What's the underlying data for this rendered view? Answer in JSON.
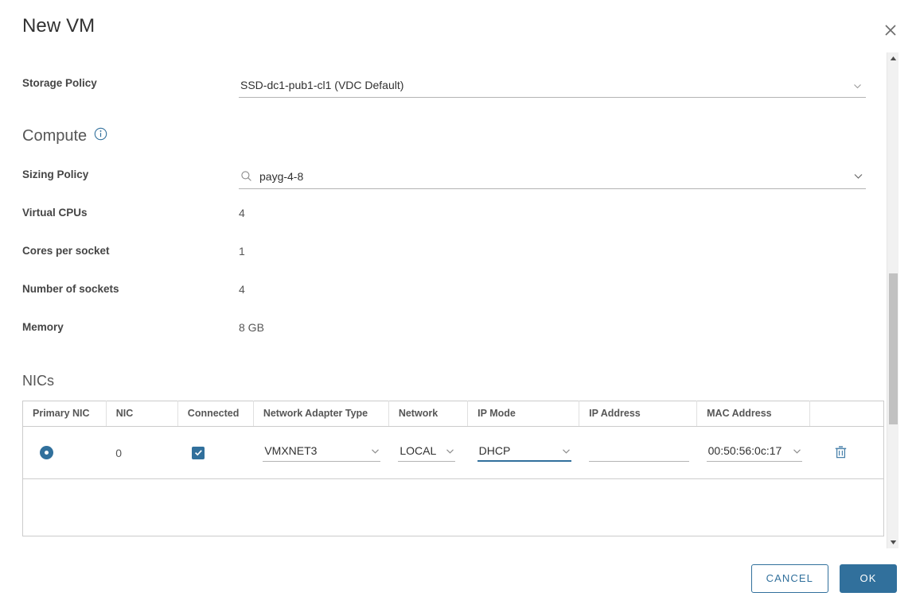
{
  "dialog": {
    "title": "New VM",
    "close_icon": "close-icon"
  },
  "storage": {
    "clipped_label": "",
    "label": "Storage Policy",
    "value": "SSD-dc1-pub1-cl1 (VDC Default)"
  },
  "compute": {
    "heading": "Compute",
    "info_icon": "info-icon",
    "sizing_policy": {
      "label": "Sizing Policy",
      "value": "payg-4-8",
      "search_icon": "search-icon"
    },
    "virtual_cpus": {
      "label": "Virtual CPUs",
      "value": "4"
    },
    "cores_per_socket": {
      "label": "Cores per socket",
      "value": "1"
    },
    "number_of_sockets": {
      "label": "Number of sockets",
      "value": "4"
    },
    "memory": {
      "label": "Memory",
      "value": "8 GB"
    }
  },
  "nics": {
    "heading": "NICs",
    "columns": [
      "Primary NIC",
      "NIC",
      "Connected",
      "Network Adapter Type",
      "Network",
      "IP Mode",
      "IP Address",
      "MAC Address",
      ""
    ],
    "rows": [
      {
        "primary": true,
        "nic": "0",
        "connected": true,
        "adapter_type": "VMXNET3",
        "network": "LOCAL",
        "ip_mode": "DHCP",
        "ip_address": "",
        "ip_address_placeholder": "",
        "mac_address": "00:50:56:0c:17",
        "delete_icon": "trash-icon"
      }
    ]
  },
  "footer": {
    "cancel_label": "CANCEL",
    "ok_label": "OK"
  },
  "colors": {
    "accent": "#31709c",
    "text": "#313131",
    "muted": "#565656",
    "border": "#cccccc"
  }
}
